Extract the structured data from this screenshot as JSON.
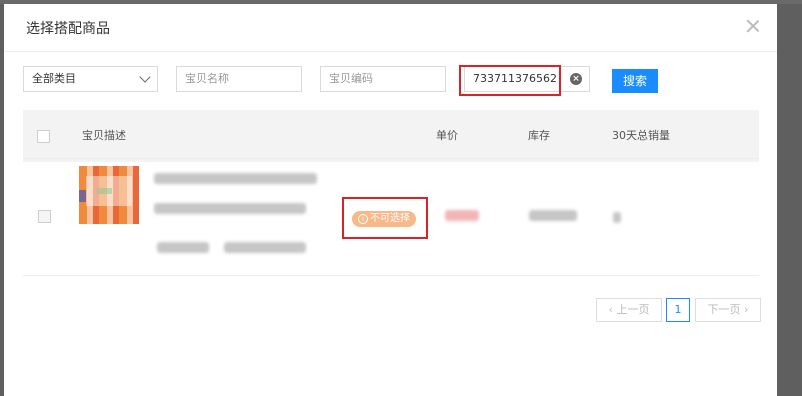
{
  "modal": {
    "title": "选择搭配商品",
    "close_icon": "close-icon"
  },
  "filters": {
    "category_select": "全部类目",
    "name_placeholder": "宝贝名称",
    "code_placeholder": "宝贝编码",
    "id_value": "733711376562",
    "clear_icon": "clear-icon",
    "search_button": "搜索"
  },
  "table": {
    "headers": [
      "宝贝描述",
      "单价",
      "库存",
      "30天总销量"
    ],
    "rows": [
      {
        "status_badge": "不可选择",
        "status_icon": "info-icon",
        "checkbox_disabled": true
      }
    ]
  },
  "pagination": {
    "prev_label": "上一页",
    "current_page": "1",
    "next_label": "下一页"
  },
  "colors": {
    "primary": "#1a8cff",
    "highlight_box": "#d9232b",
    "badge_bg": "#f7b989"
  }
}
